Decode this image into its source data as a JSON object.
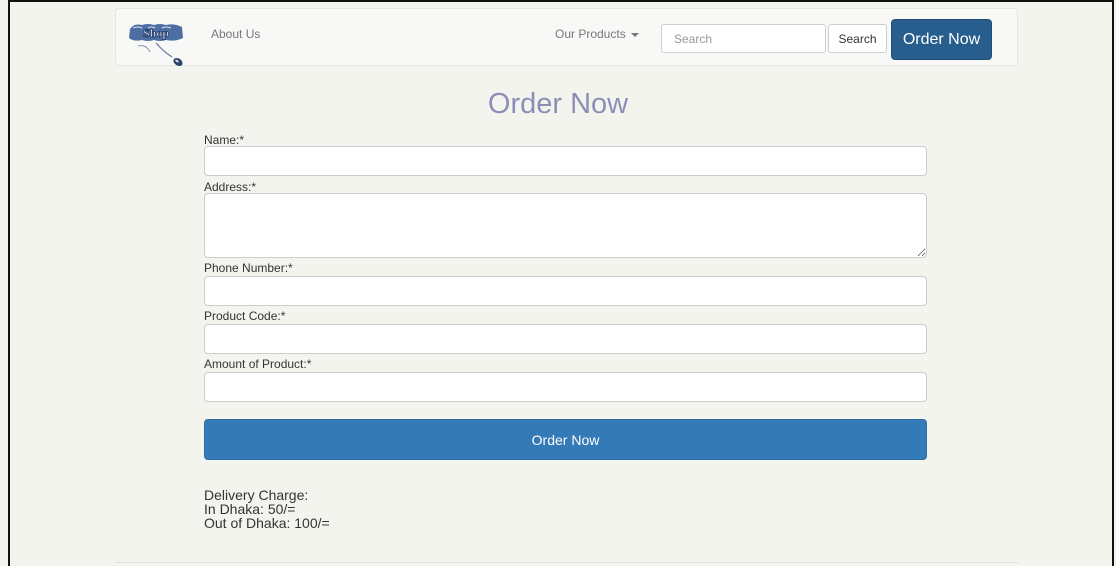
{
  "navbar": {
    "logo_text": "Shop",
    "about_label": "About Us",
    "products_label": "Our Products",
    "search_placeholder": "Search",
    "search_button_label": "Search",
    "order_button_label": "Order Now"
  },
  "form": {
    "title": "Order Now",
    "fields": [
      {
        "label": "Name:*",
        "value": ""
      },
      {
        "label": "Address:*",
        "value": ""
      },
      {
        "label": "Phone Number:*",
        "value": ""
      },
      {
        "label": "Product Code:*",
        "value": ""
      },
      {
        "label": "Amount of Product:*",
        "value": ""
      }
    ],
    "submit_label": "Order Now"
  },
  "delivery": {
    "heading": "Delivery Charge:",
    "dhaka": "In Dhaka: 50/=",
    "outside": "Out of Dhaka: 100/="
  },
  "colors": {
    "title": "#8c8fb5",
    "nav_button": "#285e8e",
    "submit_button": "#337ab7",
    "background": "#f4f4ef"
  }
}
